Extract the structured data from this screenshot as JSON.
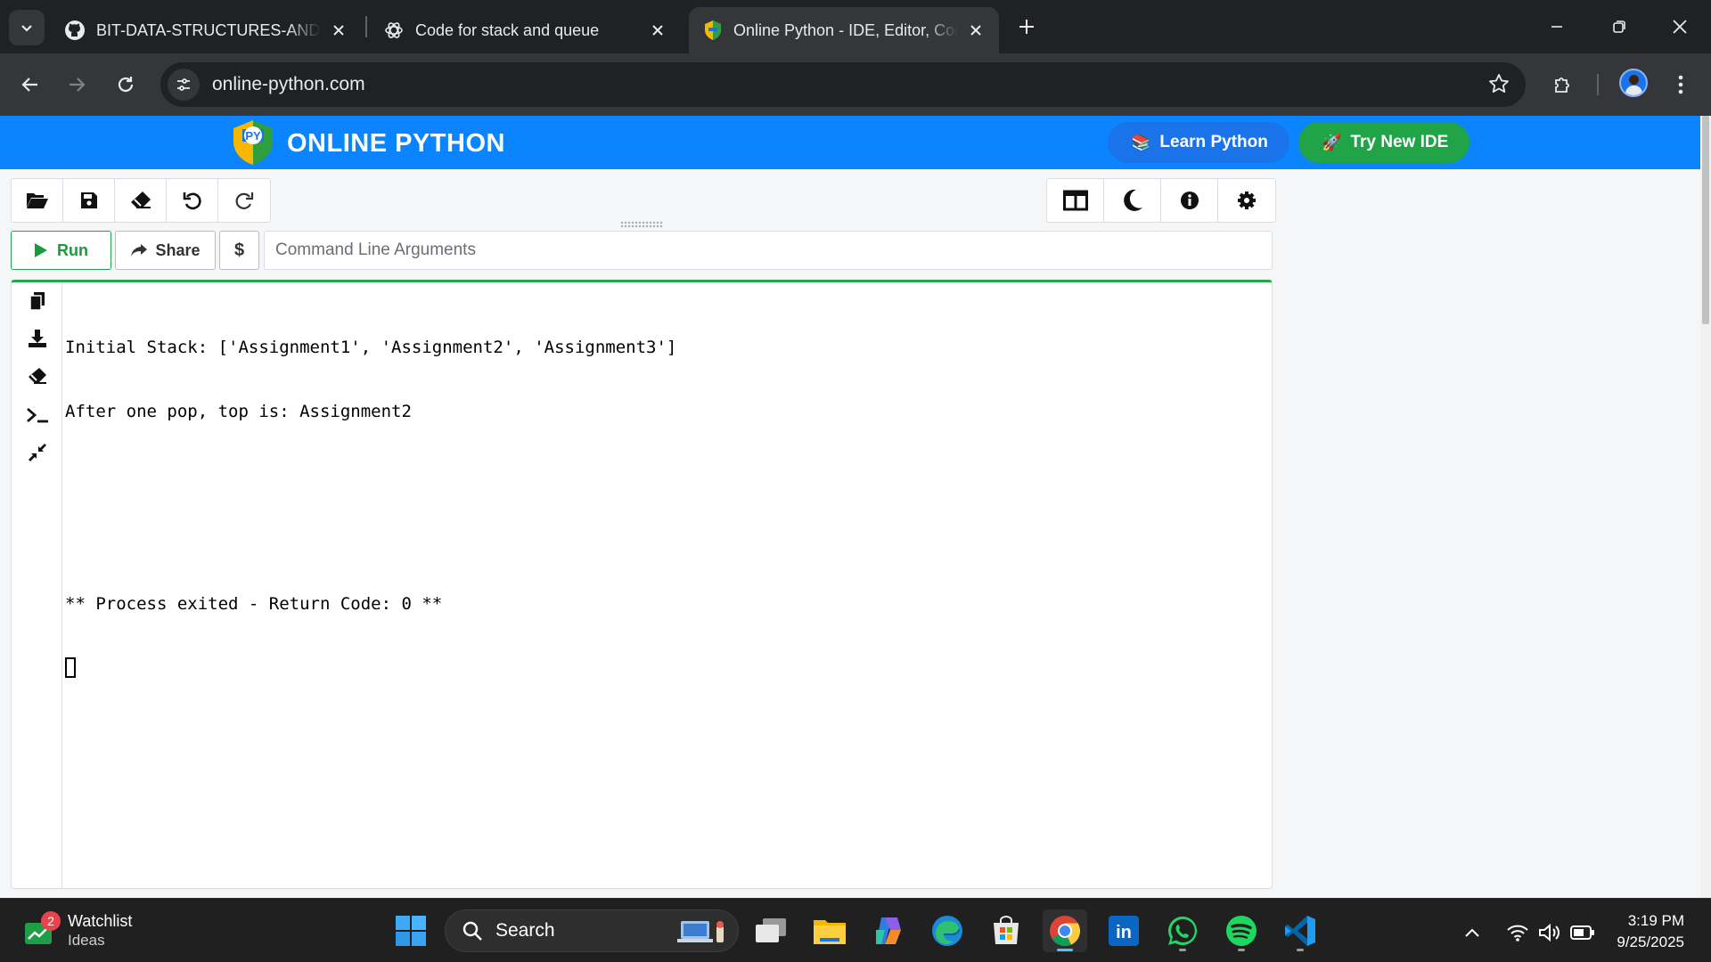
{
  "browser": {
    "tabs": [
      {
        "title": "BIT-DATA-STRUCTURES-AND-ALGORITHMS",
        "icon": "github-icon",
        "active": false
      },
      {
        "title": "Code for stack and queue",
        "icon": "chatgpt-icon",
        "active": false
      },
      {
        "title": "Online Python - IDE, Editor, Compiler",
        "icon": "online-python-icon",
        "active": true
      }
    ],
    "url": "online-python.com"
  },
  "site": {
    "brand": "ONLINE PYTHON",
    "learn_label": "Learn Python",
    "try_label": "Try New IDE",
    "colors": {
      "header": "#0a85ff",
      "learn": "#1a73e8",
      "try": "#20a447",
      "run": "#1fa44b"
    }
  },
  "toolbar": {
    "run_label": "Run",
    "share_label": "Share",
    "dollar_label": "$",
    "args_placeholder": "Command Line Arguments"
  },
  "terminal": {
    "lines": [
      "Initial Stack: ['Assignment1', 'Assignment2', 'Assignment3']",
      "After one pop, top is: Assignment2",
      "",
      "",
      "** Process exited - Return Code: 0 **"
    ]
  },
  "taskbar": {
    "widget_title": "Watchlist",
    "widget_sub": "Ideas",
    "widget_badge": "2",
    "search_label": "Search",
    "time": "3:19 PM",
    "date": "9/25/2025"
  }
}
